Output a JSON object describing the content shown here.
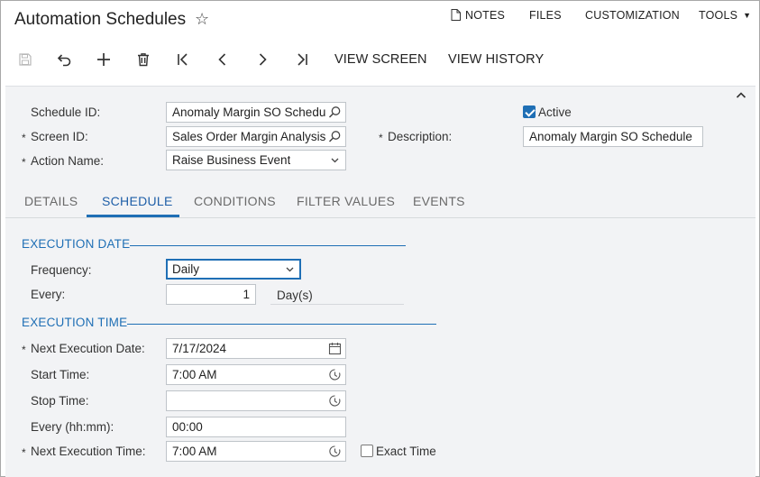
{
  "header": {
    "title": "Automation Schedules",
    "links": {
      "notes": "NOTES",
      "files": "FILES",
      "customization": "CUSTOMIZATION",
      "tools": "TOOLS"
    }
  },
  "toolbar": {
    "view_screen": "VIEW SCREEN",
    "view_history": "VIEW HISTORY"
  },
  "form": {
    "schedule_id": {
      "label": "Schedule ID:",
      "value": "Anomaly Margin SO Schedule"
    },
    "screen_id": {
      "label": "Screen ID:",
      "value": "Sales Order Margin Analysis"
    },
    "action_name": {
      "label": "Action Name:",
      "value": "Raise Business Event"
    },
    "active": {
      "label": "Active",
      "checked": true
    },
    "description": {
      "label": "Description:",
      "value": "Anomaly Margin SO Schedule"
    }
  },
  "tabs": [
    {
      "label": "DETAILS",
      "active": false
    },
    {
      "label": "SCHEDULE",
      "active": true
    },
    {
      "label": "CONDITIONS",
      "active": false
    },
    {
      "label": "FILTER VALUES",
      "active": false
    },
    {
      "label": "EVENTS",
      "active": false
    }
  ],
  "schedule": {
    "execution_date": {
      "title": "EXECUTION DATE",
      "frequency": {
        "label": "Frequency:",
        "value": "Daily"
      },
      "every": {
        "label": "Every:",
        "value": "1",
        "unit": "Day(s)"
      }
    },
    "execution_time": {
      "title": "EXECUTION TIME",
      "next_execution_date": {
        "label": "Next Execution Date:",
        "value": "7/17/2024"
      },
      "start_time": {
        "label": "Start Time:",
        "value": "7:00 AM"
      },
      "stop_time": {
        "label": "Stop Time:",
        "value": ""
      },
      "every_hhmm": {
        "label": "Every (hh:mm):",
        "value": "00:00"
      },
      "next_execution_time": {
        "label": "Next Execution Time:",
        "value": "7:00 AM"
      },
      "exact_time": {
        "label": "Exact Time",
        "checked": false
      }
    }
  },
  "colors": {
    "accent": "#1f6fb5",
    "panel_bg": "#f2f3f5"
  }
}
